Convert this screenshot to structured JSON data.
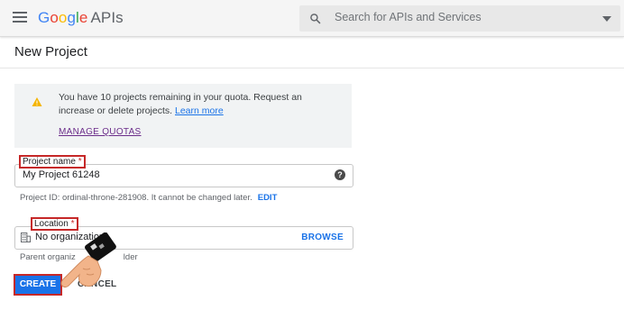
{
  "header": {
    "logo_google": [
      "G",
      "o",
      "o",
      "g",
      "l",
      "e"
    ],
    "logo_apis": "APIs",
    "search_placeholder": "Search for APIs and Services"
  },
  "page": {
    "title": "New Project"
  },
  "notice": {
    "text": "You have 10 projects remaining in your quota. Request an increase or delete projects.",
    "link": "Learn more",
    "manage_quotas": "MANAGE QUOTAS"
  },
  "project_name": {
    "label": "Project name",
    "required_marker": "*",
    "value": "My Project 61248",
    "help_icon_glyph": "?",
    "helper": "Project ID: ordinal-throne-281908. It cannot be changed later.",
    "edit": "EDIT"
  },
  "location": {
    "label": "Location",
    "required_marker": "*",
    "value": "No organization",
    "browse": "BROWSE",
    "helper_left": "Parent organiz",
    "helper_right": "lder"
  },
  "actions": {
    "create": "CREATE",
    "cancel": "CANCEL"
  },
  "colors": {
    "primary": "#1a73e8",
    "highlight_border": "#c62828",
    "quota_link": "#6b2d8a"
  }
}
